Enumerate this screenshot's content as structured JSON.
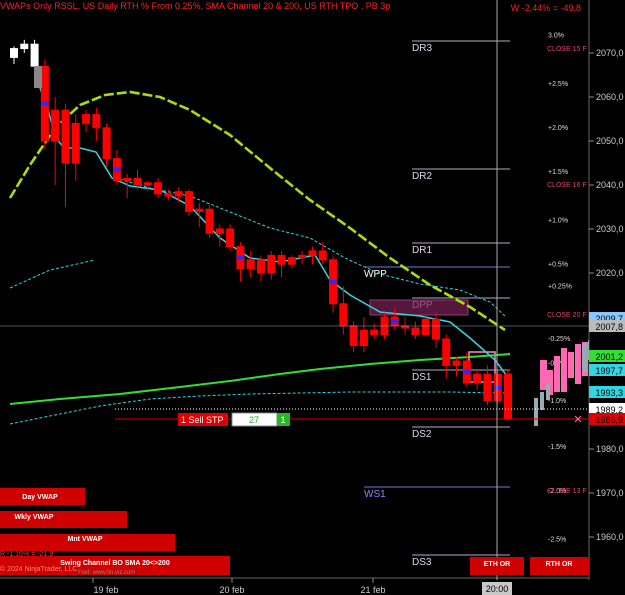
{
  "header": {
    "title": "VWAPs Only RSSL, US Daily RTH % From 0.25%, SMA Channel 20 & 200, US RTH TPO , PB 3p",
    "change": "W -2,44% = -49,8"
  },
  "colors": {
    "background": "#000000",
    "bull_candle": "#ff0000",
    "bear_candle": "#ff0000",
    "sma20": "#33d6e0",
    "sma200": "#33dd33",
    "sma_slow": "#99cc00",
    "level_line": "#9c8bb0",
    "tpo": "#ff69b4",
    "label_red": "#e10000"
  },
  "chart_data": {
    "type": "candlestick",
    "title": "",
    "y_axis": {
      "ylim": [
        1955,
        2080
      ],
      "ticks": [
        "2070,0",
        "2060,0",
        "2050,0",
        "2040,0",
        "2030,0",
        "2020,0",
        "2010,0",
        "1980,0",
        "1970,0",
        "1960,0"
      ],
      "tick_values": [
        2070,
        2060,
        2050,
        2040,
        2030,
        2020,
        2010,
        1980,
        1970,
        1960
      ]
    },
    "x_axis": {
      "labels": [
        "19 feb",
        "20 feb",
        "21 feb"
      ],
      "cursor_label": "20:00"
    },
    "price_tags": [
      {
        "value": 2009.7,
        "text": "2009,7",
        "color": "#88c8ff"
      },
      {
        "value": 2007.8,
        "text": "2007,8",
        "color": "#bbbbbb"
      },
      {
        "value": 2001.2,
        "text": "2001,2",
        "color": "#33dd33"
      },
      {
        "value": 1997.7,
        "text": "1997,7",
        "color": "#33d6e0"
      },
      {
        "value": 1993.3,
        "text": "1993,3",
        "color": "#33d6e0"
      },
      {
        "value": 1989.2,
        "text": "1989,2",
        "color": "#ffffff"
      },
      {
        "value": 1986.9,
        "text": "1986,9",
        "color": "#e10000"
      }
    ],
    "pct_levels": [
      {
        "value": 2073.5,
        "text": "3.0%"
      },
      {
        "value": 2062.5,
        "text": "+2.5%"
      },
      {
        "value": 2052.5,
        "text": "+2.0%"
      },
      {
        "value": 2042.5,
        "text": "+1.5%"
      },
      {
        "value": 2031.5,
        "text": "+1.0%"
      },
      {
        "value": 2021.5,
        "text": "+0.5%"
      },
      {
        "value": 2016.5,
        "text": "+0.25%"
      },
      {
        "value": 2004.5,
        "text": "-0.25%"
      },
      {
        "value": 1999.0,
        "text": "-0.5%"
      },
      {
        "value": 1990.5,
        "text": "-1.0%"
      },
      {
        "value": 1980.0,
        "text": "-1.5%"
      },
      {
        "value": 1970.0,
        "text": "-2.0%"
      },
      {
        "value": 1959.0,
        "text": "-2.5%"
      }
    ],
    "close_labels": [
      {
        "value": 2070.5,
        "text": "CLOSE 15 F"
      },
      {
        "value": 2039.5,
        "text": "CLOSE 16 F"
      },
      {
        "value": 2010.0,
        "text": "CLOSE 20 F"
      },
      {
        "value": 1970.0,
        "text": "CLOSE 13 F"
      }
    ],
    "levels": [
      {
        "name": "DR3",
        "value": 2080.0
      },
      {
        "name": "DR2",
        "value": 2051.5
      },
      {
        "name": "DR1",
        "value": 2032.0
      },
      {
        "name": "WPP",
        "value": 2027.5
      },
      {
        "name": "DPP",
        "value": 2014.0
      },
      {
        "name": "DS1",
        "value": 1990.0
      },
      {
        "name": "DS2",
        "value": 1981.0
      },
      {
        "name": "WS1",
        "value": 1968.0
      },
      {
        "name": "DS3",
        "value": 1953.5
      }
    ],
    "candles": [
      [
        2069.0,
        2071.5,
        2067.5,
        2071.0
      ],
      [
        2071.0,
        2073.0,
        2070.0,
        2072.0
      ],
      [
        2072.0,
        2073.0,
        2066.0,
        2067.0
      ],
      [
        2067.0,
        2068.5,
        2048.0,
        2050.0
      ],
      [
        2050.0,
        2060.0,
        2040.0,
        2057.0
      ],
      [
        2057.0,
        2058.5,
        2035.0,
        2045.0
      ],
      [
        2045.0,
        2056.0,
        2041.0,
        2054.0
      ],
      [
        2054.0,
        2057.0,
        2052.0,
        2056.0
      ],
      [
        2056.0,
        2057.5,
        2050.0,
        2053.0
      ],
      [
        2053.0,
        2054.0,
        2044.0,
        2046.0
      ],
      [
        2046.0,
        2048.0,
        2040.0,
        2041.0
      ],
      [
        2041.0,
        2042.5,
        2037.0,
        2041.5
      ],
      [
        2041.5,
        2043.5,
        2039.0,
        2040.0
      ],
      [
        2040.0,
        2041.0,
        2038.5,
        2040.5
      ],
      [
        2040.5,
        2041.5,
        2037.0,
        2038.0
      ],
      [
        2038.0,
        2039.0,
        2036.5,
        2037.5
      ],
      [
        2037.5,
        2039.5,
        2036.0,
        2038.5
      ],
      [
        2038.5,
        2039.0,
        2033.0,
        2034.0
      ],
      [
        2034.0,
        2036.0,
        2030.5,
        2034.5
      ],
      [
        2034.5,
        2035.5,
        2028.0,
        2029.0
      ],
      [
        2029.0,
        2031.0,
        2026.0,
        2030.0
      ],
      [
        2030.0,
        2031.0,
        2025.0,
        2026.0
      ],
      [
        2026.0,
        2027.0,
        2018.0,
        2021.0
      ],
      [
        2021.0,
        2025.0,
        2019.0,
        2023.0
      ],
      [
        2023.0,
        2024.0,
        2018.0,
        2020.0
      ],
      [
        2020.0,
        2025.0,
        2018.5,
        2024.0
      ],
      [
        2024.0,
        2025.0,
        2019.0,
        2022.0
      ],
      [
        2022.0,
        2024.0,
        2021.0,
        2023.5
      ],
      [
        2023.5,
        2025.0,
        2022.0,
        2024.0
      ],
      [
        2024.0,
        2026.0,
        2022.0,
        2025.0
      ],
      [
        2025.0,
        2027.0,
        2022.0,
        2023.0
      ],
      [
        2023.0,
        2024.0,
        2011.0,
        2013.0
      ],
      [
        2013.0,
        2017.0,
        2006.0,
        2008.0
      ],
      [
        2008.0,
        2009.0,
        2002.0,
        2003.5
      ],
      [
        2003.5,
        2010.0,
        2002.0,
        2007.0
      ],
      [
        2007.0,
        2008.5,
        2005.0,
        2006.0
      ],
      [
        2006.0,
        2011.0,
        2005.0,
        2010.0
      ],
      [
        2010.0,
        2012.0,
        2007.0,
        2008.0
      ],
      [
        2008.0,
        2010.0,
        2006.0,
        2007.5
      ],
      [
        2007.5,
        2009.0,
        2005.0,
        2006.0
      ],
      [
        2006.0,
        2010.0,
        2005.5,
        2009.5
      ],
      [
        2009.5,
        2011.0,
        2003.0,
        2005.0
      ],
      [
        2005.0,
        2006.0,
        1996.0,
        1999.0
      ],
      [
        1999.0,
        2001.0,
        1996.5,
        2000.0
      ],
      [
        2000.0,
        2002.0,
        1994.0,
        1995.0
      ],
      [
        1995.0,
        1998.0,
        1993.5,
        1997.0
      ],
      [
        1997.0,
        1999.0,
        1990.0,
        1991.0
      ],
      [
        1991.0,
        1998.0,
        1990.5,
        1997.0
      ],
      [
        1997.0,
        1998.0,
        1986.5,
        1987.0
      ]
    ],
    "labels": {
      "sell_stop": "1  Sell STP",
      "qty": "27",
      "qty_btn": "1",
      "copyright": "© 2024 NinjaTrader, LLC",
      "finviz": "Fwd: www.fin.viz.com",
      "eth_or": "ETH OR",
      "rth_or": "RTH OR",
      "pct_label": "R -1.16% = -21.9"
    },
    "vwap_boxes": [
      "Day VWAP",
      "Wkly VWAP",
      "Mnt VWAP",
      "Swing Channel BO SMA 20<>200"
    ]
  }
}
